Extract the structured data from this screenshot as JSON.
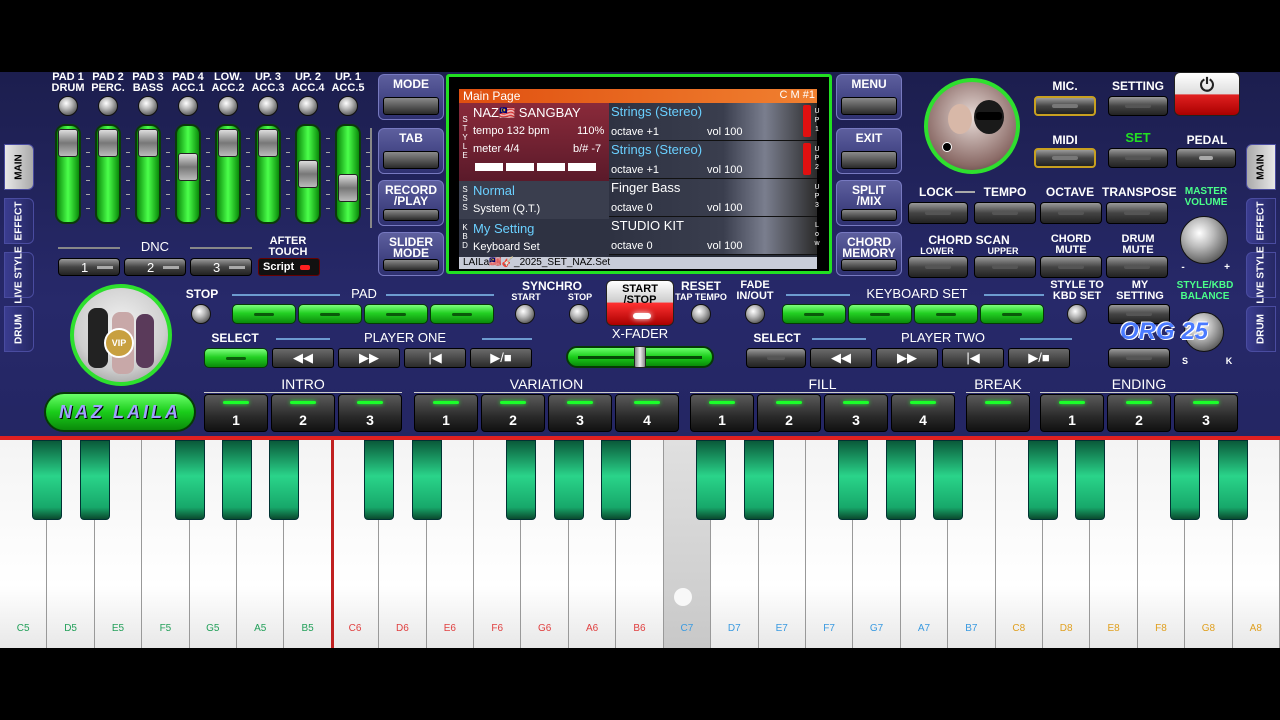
{
  "pads": {
    "labels": [
      [
        "PAD 1",
        "DRUM"
      ],
      [
        "PAD 2",
        "PERC."
      ],
      [
        "PAD 3",
        "BASS"
      ],
      [
        "PAD 4",
        "ACC.1"
      ],
      [
        "LOW.",
        "ACC.2"
      ],
      [
        "UP. 3",
        "ACC.3"
      ],
      [
        "UP. 2",
        "ACC.4"
      ],
      [
        "UP. 1",
        "ACC.5"
      ]
    ],
    "slider_levels": [
      0.95,
      0.95,
      0.95,
      0.6,
      0.95,
      0.95,
      0.5,
      0.3
    ]
  },
  "left_tabs": [
    "MAIN",
    "EFFECT",
    "LIVE STYLE",
    "DRUM"
  ],
  "right_tabs": [
    "MAIN",
    "EFFECT",
    "LIVE STYLE",
    "DRUM"
  ],
  "center_tabs": [
    [
      "MODE"
    ],
    [
      "TAB"
    ],
    [
      "RECORD",
      "/PLAY"
    ],
    [
      "SLIDER",
      "MODE"
    ]
  ],
  "right_center_tabs": [
    [
      "MENU"
    ],
    [
      "EXIT"
    ],
    [
      "SPLIT",
      "/MIX"
    ],
    [
      "CHORD",
      "MEMORY"
    ]
  ],
  "dnc": {
    "title": "DNC",
    "buttons": [
      "1",
      "2",
      "3"
    ],
    "after_touch": [
      "AFTER",
      "TOUCH"
    ],
    "script": "Script"
  },
  "screen": {
    "title": "Main Page",
    "badge": "C M #1",
    "style_name": "NAZ🇲🇾 SANGBAY",
    "tempo": "tempo 132 bpm",
    "percent": "110%",
    "meter": "meter 4/4",
    "key": "b/# -7",
    "sss_name": "Normal",
    "sss_sub": "System (Q.T.)",
    "kbd_name": "My Setting",
    "kbd_sub": "Keyboard Set",
    "footer": "LAILa🇲🇾🎸_2025_SET_NAZ.Set",
    "left_vert": [
      "S",
      "T",
      "Y",
      "L",
      "E"
    ],
    "sss_vert": [
      "S",
      "S",
      "S"
    ],
    "kbd_vert": [
      "K",
      "B",
      "D"
    ],
    "voices": [
      {
        "name": "Strings (Stereo)",
        "octave": "octave +1",
        "vol": "vol 100",
        "tag": [
          "U",
          "P",
          "1"
        ],
        "red": true
      },
      {
        "name": "Strings (Stereo)",
        "octave": "octave +1",
        "vol": "vol 100",
        "tag": [
          "U",
          "P",
          "2"
        ],
        "red": true
      },
      {
        "name": "Finger Bass",
        "octave": "octave  0",
        "vol": "vol 100",
        "tag": [
          "U",
          "P",
          "3"
        ],
        "red": false
      },
      {
        "name": "STUDIO KIT",
        "octave": "octave  0",
        "vol": "vol 100",
        "tag": [
          "L",
          "o",
          "w"
        ],
        "red": false
      }
    ]
  },
  "top_right": {
    "mic": "MIC.",
    "setting": "SETTING",
    "midi": "MIDI",
    "set": "SET",
    "pedal": "PEDAL",
    "lock": "LOCK",
    "tempo": "TEMPO",
    "octave": "OCTAVE",
    "transpose": "TRANSPOSE",
    "master_volume": [
      "MASTER",
      "VOLUME"
    ],
    "chord_scan": "CHORD SCAN",
    "lower": "LOWER",
    "upper": "UPPER",
    "chord_mute": [
      "CHORD",
      "MUTE"
    ],
    "drum_mute": [
      "DRUM",
      "MUTE"
    ],
    "vol_minus": "-",
    "vol_plus": "+"
  },
  "middle": {
    "stop": "STOP",
    "pad": "PAD",
    "synchro": "SYNCHRO",
    "start": "START",
    "stop2": "STOP",
    "start_stop": [
      "START",
      "/STOP"
    ],
    "reset": "RESET",
    "tap_tempo": "TAP TEMPO",
    "fade": [
      "FADE",
      "IN/OUT"
    ],
    "keyboard_set": "KEYBOARD SET",
    "style_to_kbd": [
      "STYLE TO",
      "KBD SET"
    ],
    "my_setting": [
      "MY",
      "SETTING"
    ],
    "style_kbd_balance": [
      "STYLE/KBD",
      "BALANCE"
    ],
    "bal_s": "S",
    "bal_k": "K",
    "select": "SELECT",
    "player_one": "PLAYER ONE",
    "xfader": "X-FADER",
    "select2": "SELECT",
    "player_two": "PLAYER TWO",
    "org": "ORG 25"
  },
  "player_glyphs": [
    "◀◀",
    "▶▶",
    "|◀",
    "▶/■"
  ],
  "brand": "NAZ LAILA",
  "sections": [
    {
      "title": "INTRO",
      "buttons": [
        "1",
        "2",
        "3"
      ]
    },
    {
      "title": "VARIATION",
      "buttons": [
        "1",
        "2",
        "3",
        "4"
      ]
    },
    {
      "title": "FILL",
      "buttons": [
        "1",
        "2",
        "3",
        "4"
      ]
    },
    {
      "title": "BREAK",
      "buttons": [
        ""
      ]
    },
    {
      "title": "ENDING",
      "buttons": [
        "1",
        "2",
        "3"
      ]
    }
  ],
  "keys": [
    "C5",
    "D5",
    "E5",
    "F5",
    "G5",
    "A5",
    "B5",
    "C6",
    "D6",
    "E6",
    "F6",
    "G6",
    "A6",
    "B6",
    "C7",
    "D7",
    "E7",
    "F7",
    "G7",
    "A7",
    "B7",
    "C8",
    "D8",
    "E8",
    "F8",
    "G8",
    "A8"
  ],
  "key_colors": {
    "o5": "#23a05a",
    "o6": "#e04040",
    "o7": "#3a9ae0",
    "o8": "#e0a020"
  }
}
